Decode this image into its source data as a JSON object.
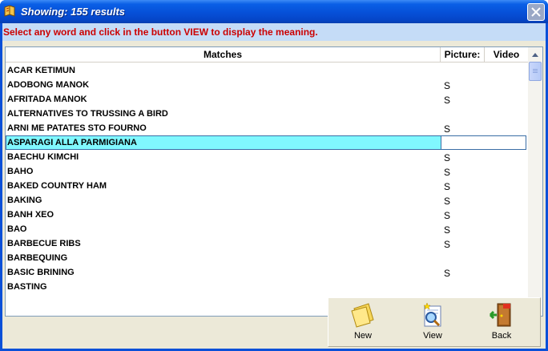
{
  "window": {
    "title": "Showing: 155 results",
    "icon": "book-icon",
    "close_icon": "close-icon"
  },
  "instruction": "Select any word and click in the button VIEW to display the meaning.",
  "list": {
    "columns": [
      "Matches",
      "Picture:",
      "Video"
    ],
    "rows": [
      {
        "name": "ACAR KETIMUN",
        "picture": ""
      },
      {
        "name": "ADOBONG MANOK",
        "picture": "S"
      },
      {
        "name": "AFRITADA MANOK",
        "picture": "S"
      },
      {
        "name": "ALTERNATIVES TO TRUSSING A BIRD",
        "picture": ""
      },
      {
        "name": "ARNI ME PATATES STO FOURNO",
        "picture": "S"
      },
      {
        "name": "ASPARAGI ALLA PARMIGIANA",
        "picture": ""
      },
      {
        "name": "BAECHU KIMCHI",
        "picture": "S"
      },
      {
        "name": "BAHO",
        "picture": "S"
      },
      {
        "name": "BAKED COUNTRY HAM",
        "picture": "S"
      },
      {
        "name": "BAKING",
        "picture": "S"
      },
      {
        "name": "BANH XEO",
        "picture": "S"
      },
      {
        "name": "BAO",
        "picture": "S"
      },
      {
        "name": "BARBECUE RIBS",
        "picture": "S"
      },
      {
        "name": "BARBEQUING",
        "picture": ""
      },
      {
        "name": "BASIC BRINING",
        "picture": "S"
      },
      {
        "name": "BASTING",
        "picture": ""
      }
    ],
    "selected_index": 5
  },
  "toolbar": {
    "new_label": "New",
    "new_icon": "new-sheet-icon",
    "view_label": "View",
    "view_icon": "view-magnifier-icon",
    "back_label": "Back",
    "back_icon": "exit-door-icon"
  }
}
